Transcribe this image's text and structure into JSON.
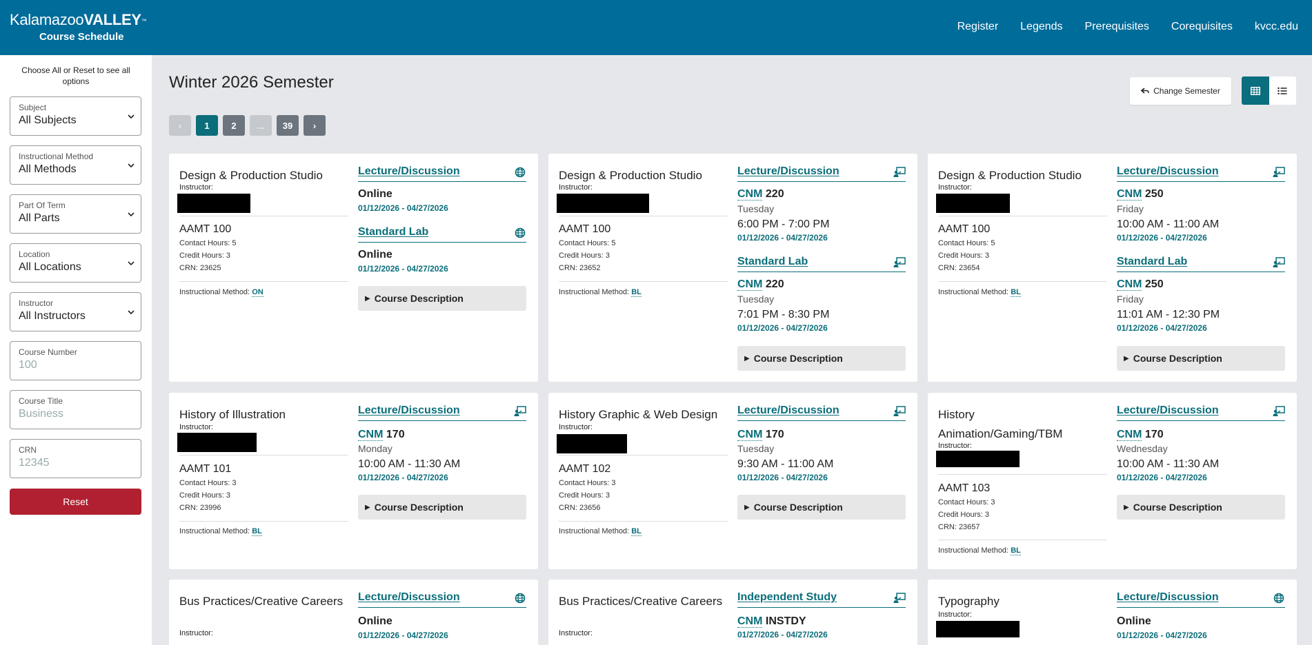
{
  "header": {
    "logo_part1": "Kalamazoo",
    "logo_part2": "VALLEY",
    "logo_tm": "™",
    "subtitle": "Course Schedule",
    "nav": [
      "Register",
      "Legends",
      "Prerequisites",
      "Corequisites",
      "kvcc.edu"
    ]
  },
  "sidebar": {
    "hint": "Choose All or Reset to see all options",
    "filters": [
      {
        "label": "Subject",
        "value": "All Subjects"
      },
      {
        "label": "Instructional Method",
        "value": "All Methods"
      },
      {
        "label": "Part Of Term",
        "value": "All Parts"
      },
      {
        "label": "Location",
        "value": "All Locations"
      },
      {
        "label": "Instructor",
        "value": "All Instructors"
      }
    ],
    "inputs": [
      {
        "label": "Course Number",
        "placeholder": "100"
      },
      {
        "label": "Course Title",
        "placeholder": "Business"
      },
      {
        "label": "CRN",
        "placeholder": "12345"
      }
    ],
    "reset_label": "Reset"
  },
  "main": {
    "semester_title": "Winter 2026 Semester",
    "change_semester_label": "Change Semester",
    "pager": [
      "‹",
      "1",
      "2",
      "...",
      "39",
      "›"
    ],
    "card_text": {
      "instructor_label": "Instructor:",
      "method_label": "Instructional Method:",
      "course_description_label": "Course Description",
      "online": "Online",
      "cnm": "CNM"
    },
    "cards": [
      {
        "title": "Design & Production Studio",
        "code": "AAMT 100",
        "contact": "Contact Hours: 5",
        "credit": "Credit Hours: 3",
        "crn": "CRN: 23625",
        "method": "ON",
        "sections": [
          {
            "type": "Lecture/Discussion",
            "location": "Online",
            "dates": "01/12/2026 - 04/27/2026"
          },
          {
            "type": "Standard Lab",
            "location": "Online",
            "dates": "01/12/2026 - 04/27/2026"
          }
        ]
      },
      {
        "title": "Design & Production Studio",
        "code": "AAMT 100",
        "contact": "Contact Hours: 5",
        "credit": "Credit Hours: 3",
        "crn": "CRN: 23652",
        "method": "BL",
        "sections": [
          {
            "type": "Lecture/Discussion",
            "room": "220",
            "day": "Tuesday",
            "time": "6:00 PM - 7:00 PM",
            "dates": "01/12/2026 - 04/27/2026"
          },
          {
            "type": "Standard Lab",
            "room": "220",
            "day": "Tuesday",
            "time": "7:01 PM - 8:30 PM",
            "dates": "01/12/2026 - 04/27/2026"
          }
        ]
      },
      {
        "title": "Design & Production Studio",
        "code": "AAMT 100",
        "contact": "Contact Hours: 5",
        "credit": "Credit Hours: 3",
        "crn": "CRN: 23654",
        "method": "BL",
        "sections": [
          {
            "type": "Lecture/Discussion",
            "room": "250",
            "day": "Friday",
            "time": "10:00 AM - 11:00 AM",
            "dates": "01/12/2026 - 04/27/2026"
          },
          {
            "type": "Standard Lab",
            "room": "250",
            "day": "Friday",
            "time": "11:01 AM - 12:30 PM",
            "dates": "01/12/2026 - 04/27/2026"
          }
        ]
      },
      {
        "title": "History of Illustration",
        "code": "AAMT 101",
        "contact": "Contact Hours: 3",
        "credit": "Credit Hours: 3",
        "crn": "CRN: 23996",
        "method": "BL",
        "sections": [
          {
            "type": "Lecture/Discussion",
            "room": "170",
            "day": "Monday",
            "time": "10:00 AM - 11:30 AM",
            "dates": "01/12/2026 - 04/27/2026"
          }
        ]
      },
      {
        "title": "History Graphic & Web Design",
        "code": "AAMT 102",
        "contact": "Contact Hours: 3",
        "credit": "Credit Hours: 3",
        "crn": "CRN: 23656",
        "method": "BL",
        "sections": [
          {
            "type": "Lecture/Discussion",
            "room": "170",
            "day": "Tuesday",
            "time": "9:30 AM - 11:00 AM",
            "dates": "01/12/2026 - 04/27/2026"
          }
        ]
      },
      {
        "title": "History Animation/Gaming/TBM",
        "code": "AAMT 103",
        "contact": "Contact Hours: 3",
        "credit": "Credit Hours: 3",
        "crn": "CRN: 23657",
        "method": "BL",
        "sections": [
          {
            "type": "Lecture/Discussion",
            "room": "170",
            "day": "Wednesday",
            "time": "10:00 AM - 11:30 AM",
            "dates": "01/12/2026 - 04/27/2026"
          }
        ]
      },
      {
        "title": "Bus Practices/Creative Careers",
        "sections": [
          {
            "type": "Lecture/Discussion",
            "location": "Online",
            "dates": "01/12/2026 - 04/27/2026"
          }
        ]
      },
      {
        "title": "Bus Practices/Creative Careers",
        "sections": [
          {
            "type": "Independent Study",
            "room": "INSTDY",
            "dates": "01/27/2026 - 04/27/2026"
          }
        ]
      },
      {
        "title": "Typography",
        "sections": [
          {
            "type": "Lecture/Discussion",
            "location": "Online",
            "dates": "01/12/2026 - 04/27/2026"
          }
        ]
      }
    ]
  }
}
